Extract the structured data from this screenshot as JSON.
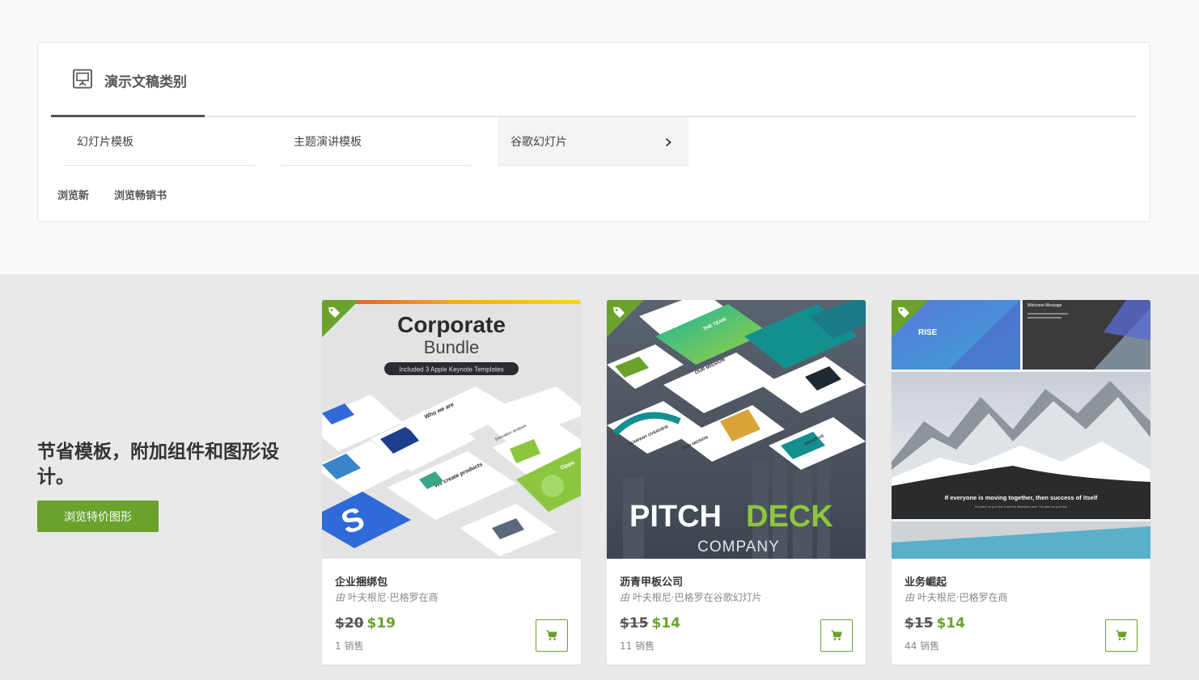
{
  "category_panel": {
    "title": "演示文稿类别",
    "tabs": [
      {
        "label": "幻灯片模板"
      },
      {
        "label": "主题演讲模板"
      },
      {
        "label": "谷歌幻灯片"
      }
    ],
    "browse_links": [
      "浏览新",
      "浏览畅销书"
    ]
  },
  "promo": {
    "title": "节省模板，附加组件和图形设计。",
    "button_label": "浏览特价图形"
  },
  "cards": [
    {
      "name": "企业捆绑包",
      "author_prefix": "由",
      "author": "叶夫根尼·巴格罗在商",
      "old_price": "$20",
      "new_price": "$19",
      "sales": "1 销售",
      "thumb_title": "Corporate",
      "thumb_subtitle": "Bundle",
      "thumb_badge": "Included 3 Apple Keynote Templates",
      "thumb_slide_texts": [
        "Who we are",
        "Education analysis",
        "We create products",
        "Oppo"
      ]
    },
    {
      "name": "沥青甲板公司",
      "author_prefix": "由",
      "author": "叶夫根尼·巴格罗在谷歌幻灯片",
      "old_price": "$15",
      "new_price": "$14",
      "sales": "11 销售",
      "thumb_title_a": "PITCH",
      "thumb_title_b": "DECK",
      "thumb_subtitle": "COMPANY",
      "thumb_slide_texts": [
        "THE TEAM",
        "OUR MISSION",
        "COMPANY OVERVIEW",
        "ABOUT US",
        "OUR MISSION"
      ]
    },
    {
      "name": "业务崛起",
      "author_prefix": "由",
      "author": "叶夫根尼·巴格罗在商",
      "old_price": "$15",
      "new_price": "$14",
      "sales": "44 销售",
      "thumb_slide_title": "RISE",
      "thumb_welcome": "Welcome Message",
      "thumb_quote": "If everyone is moving together, then success of itself",
      "thumb_quote_sub": "The place for your text. Insert the description here. The place for your text."
    }
  ],
  "colors": {
    "accent_green": "#6aa22b",
    "promo_bg": "#e9e9e9"
  },
  "icons": {
    "category": "presentation-icon",
    "tab_arrow": "chevron-right-icon",
    "card_tag": "tag-icon",
    "cart": "shopping-cart-icon"
  }
}
